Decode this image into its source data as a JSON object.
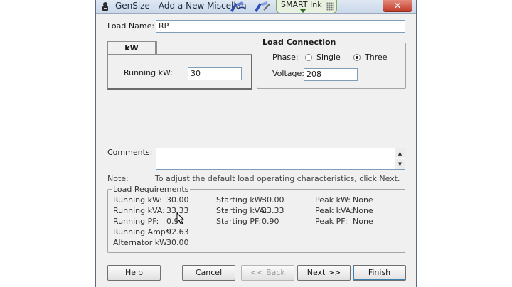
{
  "window": {
    "title": "GenSize - Add a New Miscellan",
    "close_glyph": "✕"
  },
  "toolbar": {
    "smart_ink_label": "SMART Ink",
    "tool1": "pen-tool-icon",
    "tool2": "pen-tool-icon",
    "dropdown": "chevron-down-icon"
  },
  "form": {
    "load_name_label": "Load Name:",
    "load_name_value": "RP",
    "tab_kw_label": "kW",
    "running_kw_label": "Running kW:",
    "running_kw_value": "30",
    "load_connection": {
      "title": "Load Connection",
      "phase_label": "Phase:",
      "phase_options": [
        "Single",
        "Three"
      ],
      "phase_selected": "Three",
      "voltage_label": "Voltage:",
      "voltage_value": "208"
    },
    "comments_label": "Comments:",
    "comments_value": "",
    "note_label": "Note:",
    "note_text": "To adjust the default load operating characteristics, click Next."
  },
  "requirements": {
    "title": "Load Requirements",
    "col1": [
      {
        "label": "Running kW:",
        "value": "30.00"
      },
      {
        "label": "Running kVA:",
        "value": "33.33"
      },
      {
        "label": "Running PF:",
        "value": "0.90"
      },
      {
        "label": "Running Amps:",
        "value": "92.63"
      },
      {
        "label": "Alternator kW:",
        "value": "30.00"
      }
    ],
    "col2": [
      {
        "label": "Starting kW:",
        "value": "30.00"
      },
      {
        "label": "Starting kVA:",
        "value": "33.33"
      },
      {
        "label": "Starting PF:",
        "value": "0.90"
      }
    ],
    "col3": [
      {
        "label": "Peak kW:",
        "value": "None"
      },
      {
        "label": "Peak kVA:",
        "value": "None"
      },
      {
        "label": "Peak PF:",
        "value": "None"
      }
    ]
  },
  "buttons": {
    "help": "Help",
    "cancel": "Cancel",
    "back": "<< Back",
    "next": "Next >>",
    "finish": "Finish"
  }
}
